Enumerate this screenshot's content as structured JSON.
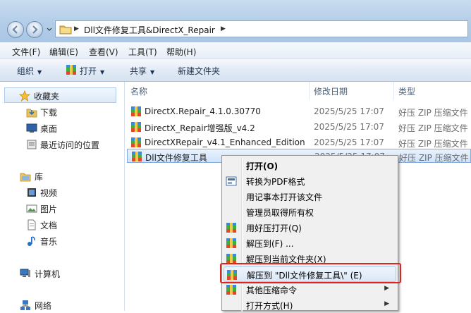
{
  "address": {
    "path": "Dll文件修复工具&DirectX_Repair"
  },
  "menubar": [
    "文件(F)",
    "编辑(E)",
    "查看(V)",
    "工具(T)",
    "帮助(H)"
  ],
  "toolbar": {
    "organize": "组织",
    "open": "打开",
    "share": "共享",
    "new_folder": "新建文件夹"
  },
  "nav": {
    "favorites": "收藏夹",
    "downloads": "下载",
    "desktop": "桌面",
    "recent": "最近访问的位置",
    "library": "库",
    "videos": "视频",
    "pictures": "图片",
    "documents": "文档",
    "music": "音乐",
    "computer": "计算机",
    "network": "网络"
  },
  "columns": {
    "name": "名称",
    "date": "修改日期",
    "type": "类型"
  },
  "files": [
    {
      "name": "DirectX.Repair_4.1.0.30770",
      "date": "2025/5/25 17:07",
      "type": "好压 ZIP 压缩文件"
    },
    {
      "name": "DirectX_Repair增强版_v4.2",
      "date": "2025/5/25 17:07",
      "type": "好压 ZIP 压缩文件"
    },
    {
      "name": "DirectXRepair_v4.1_Enhanced_Edition",
      "date": "2025/5/25 17:07",
      "type": "好压 ZIP 压缩文件"
    },
    {
      "name": "Dll文件修复工具",
      "date": "2025/5/25 17:07",
      "type": "好压 ZIP 压缩文件"
    }
  ],
  "context_menu": {
    "open": "打开(O)",
    "to_pdf": "转换为PDF格式",
    "notepad": "用记事本打开该文件",
    "owner": "管理员取得所有权",
    "haozip_open": "用好压打开(Q)",
    "extract_to": "解压到(F) ...",
    "extract_here": "解压到当前文件夹(X)",
    "extract_named": "解压到 \"Dll文件修复工具\\\" (E)",
    "other": "其他压缩命令",
    "open_with": "打开方式(H)"
  },
  "colors": {
    "highlight_box": "#e4231e",
    "selection": "#cfe3fb"
  }
}
